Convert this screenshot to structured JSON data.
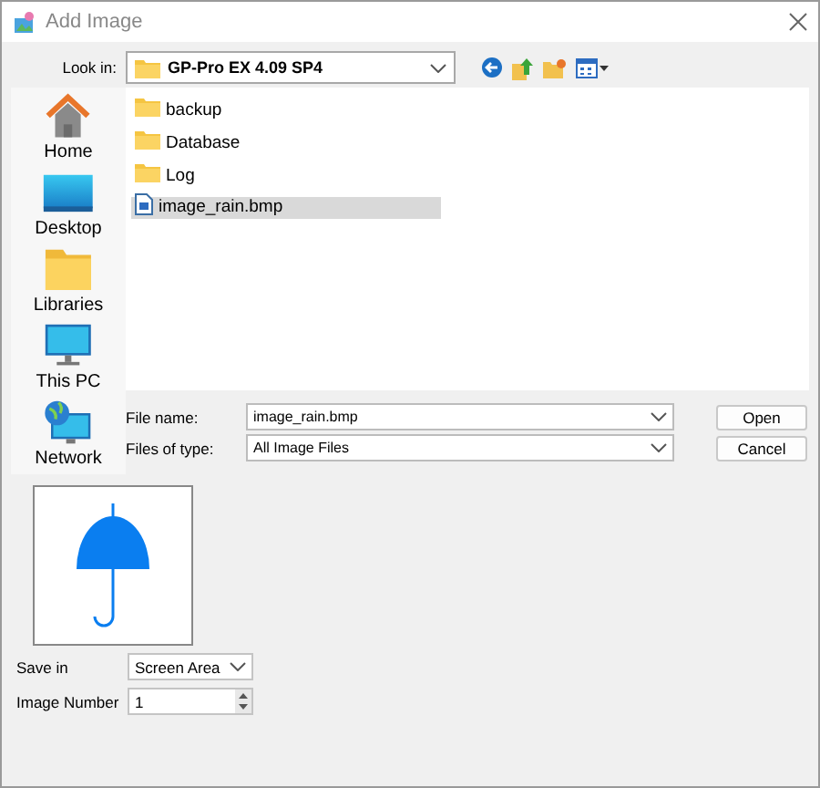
{
  "window": {
    "title": "Add Image"
  },
  "look_in": {
    "label": "Look in:",
    "value": "GP-Pro EX 4.09 SP4"
  },
  "places": [
    {
      "label": "Home",
      "kind": "home"
    },
    {
      "label": "Desktop",
      "kind": "desktop"
    },
    {
      "label": "Libraries",
      "kind": "libraries"
    },
    {
      "label": "This PC",
      "kind": "pc"
    },
    {
      "label": "Network",
      "kind": "network"
    }
  ],
  "files": [
    {
      "name": "backup",
      "kind": "folder",
      "selected": false
    },
    {
      "name": "Database",
      "kind": "folder",
      "selected": false
    },
    {
      "name": "Log",
      "kind": "folder",
      "selected": false
    },
    {
      "name": "image_rain.bmp",
      "kind": "image",
      "selected": true
    }
  ],
  "file_name": {
    "label": "File name:",
    "value": "image_rain.bmp"
  },
  "file_type": {
    "label": "Files of type:",
    "value": "All Image Files"
  },
  "buttons": [
    "Open",
    "Cancel"
  ],
  "save_in": {
    "label": "Save in",
    "value": "Screen Area"
  },
  "image_number": {
    "label": "Image Number",
    "value": "1"
  }
}
